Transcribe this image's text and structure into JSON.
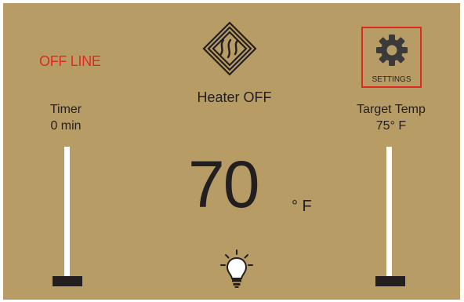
{
  "status": {
    "text": "OFF LINE",
    "color": "#e02a20"
  },
  "heater": {
    "status": "Heater OFF",
    "logo_icon": "heater-flame-logo-icon"
  },
  "settings": {
    "label": "SETTINGS",
    "icon": "gear-icon"
  },
  "timer": {
    "title": "Timer",
    "value": "0 min",
    "level": 0
  },
  "target": {
    "title": "Target Temp",
    "value": "75° F",
    "level": 0
  },
  "current": {
    "temperature": "70",
    "unit": "° F"
  },
  "light": {
    "icon": "light-bulb-icon"
  },
  "colors": {
    "background": "#b89c65",
    "text": "#231f20",
    "accent": "#e02a20",
    "track": "#ffffff"
  }
}
